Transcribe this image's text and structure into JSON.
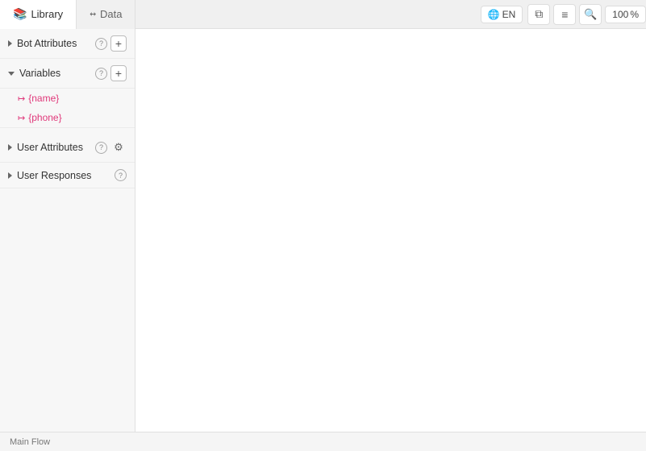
{
  "header": {
    "tabs": [
      {
        "id": "library",
        "label": "Library",
        "icon": "📚",
        "active": true
      },
      {
        "id": "data",
        "label": "Data",
        "icon": "↔",
        "active": false
      }
    ],
    "actions": {
      "language": "EN",
      "language_icon": "🌐",
      "copy_icon": "⧉",
      "list_icon": "≡",
      "zoom_icon": "🔍",
      "zoom_level": "100"
    }
  },
  "sidebar": {
    "sections": [
      {
        "id": "bot-attributes",
        "label": "Bot Attributes",
        "expanded": false,
        "has_add": true,
        "has_help": true
      },
      {
        "id": "variables",
        "label": "Variables",
        "expanded": true,
        "has_add": true,
        "has_help": true,
        "items": [
          {
            "id": "name",
            "label": "{name}"
          },
          {
            "id": "phone",
            "label": "{phone}"
          }
        ]
      },
      {
        "id": "user-attributes",
        "label": "User Attributes",
        "expanded": false,
        "has_add": false,
        "has_help": true,
        "has_gear": true
      },
      {
        "id": "user-responses",
        "label": "User Responses",
        "expanded": false,
        "has_add": false,
        "has_help": true
      }
    ]
  },
  "canvas": {
    "background": "#ffffff"
  },
  "bottom_bar": {
    "label": "Main Flow"
  }
}
